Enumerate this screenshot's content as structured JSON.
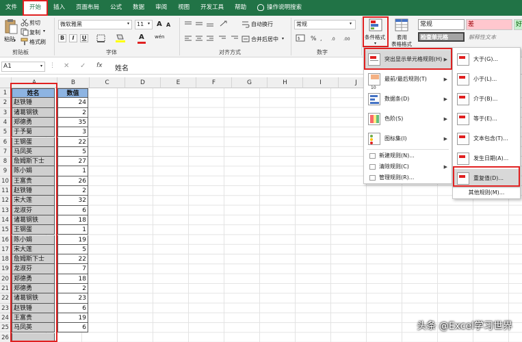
{
  "tabs": [
    "文件",
    "开始",
    "插入",
    "页面布局",
    "公式",
    "数据",
    "审阅",
    "视图",
    "开发工具",
    "帮助",
    "操作说明搜索"
  ],
  "clipboard": {
    "paste": "粘贴",
    "cut": "剪切",
    "copy": "复制",
    "format_painter": "格式刷",
    "label": "剪贴板"
  },
  "font": {
    "name": "微软雅黑",
    "size": "11",
    "bold": "B",
    "italic": "I",
    "underline": "U",
    "grow": "A",
    "shrink": "A",
    "color_a": "A",
    "wen": "wén",
    "label": "字体"
  },
  "alignment": {
    "wrap": "自动换行",
    "merge": "合并后居中",
    "label": "对齐方式"
  },
  "number": {
    "format": "常规",
    "label": "数字"
  },
  "styles": {
    "conditional": "条件格式",
    "table": "套用",
    "table2": "表格格式",
    "normal": "常规",
    "bad": "差",
    "good": "好",
    "check": "检查单元格",
    "explain": "解释性文本"
  },
  "formula_bar": {
    "name_box": "A1",
    "fx": "fx",
    "value": "姓名"
  },
  "columns": [
    "A",
    "B",
    "C",
    "D",
    "E",
    "F",
    "G",
    "H",
    "I",
    "J"
  ],
  "table": {
    "headers": [
      "姓名",
      "数值"
    ],
    "rows": [
      [
        "赵铁锤",
        "24"
      ],
      [
        "诸葛钢铁",
        "2"
      ],
      [
        "郑德勇",
        "35"
      ],
      [
        "于予菊",
        "3"
      ],
      [
        "王钢蛋",
        "22"
      ],
      [
        "马凤英",
        "5"
      ],
      [
        "詹姆斯下士",
        "27"
      ],
      [
        "陈小娟",
        "1"
      ],
      [
        "王富贵",
        "26"
      ],
      [
        "赵铁锤",
        "2"
      ],
      [
        "宋大莲",
        "32"
      ],
      [
        "龙淑芬",
        "6"
      ],
      [
        "诸葛钢铁",
        "18"
      ],
      [
        "王钢蛋",
        "1"
      ],
      [
        "陈小娟",
        "19"
      ],
      [
        "宋大莲",
        "5"
      ],
      [
        "詹姆斯下士",
        "22"
      ],
      [
        "龙淑芬",
        "7"
      ],
      [
        "郑德勇",
        "18"
      ],
      [
        "郑德勇",
        "2"
      ],
      [
        "诸葛钢铁",
        "23"
      ],
      [
        "赵铁锤",
        "6"
      ],
      [
        "王富贵",
        "19"
      ],
      [
        "马凤英",
        "6"
      ]
    ],
    "row_numbers": [
      "1",
      "2",
      "3",
      "4",
      "5",
      "6",
      "7",
      "8",
      "9",
      "10",
      "11",
      "12",
      "13",
      "14",
      "15",
      "16",
      "17",
      "18",
      "19",
      "20",
      "21",
      "22",
      "23",
      "24",
      "25",
      "26"
    ]
  },
  "cf_menu": {
    "items": [
      "突出显示单元格规则(H)",
      "最前/最后规则(T)",
      "数据条(D)",
      "色阶(S)",
      "图标集(I)"
    ],
    "small_items": [
      "新建规则(N)...",
      "清除规则(C)",
      "管理规则(R)..."
    ],
    "icon_label_10": "10"
  },
  "sub_menu": {
    "items": [
      "大于(G)...",
      "小于(L)...",
      "介于(B)...",
      "等于(E)...",
      "文本包含(T)...",
      "发生日期(A)...",
      "重复值(D)..."
    ],
    "more": "其他规则(M)..."
  },
  "watermark": "头条 @Excel学习世界",
  "colors": {
    "excel_green": "#217346",
    "header_blue": "#8db4e2",
    "highlight_red": "#e02020",
    "bad_fill": "#ffc7ce",
    "good_fill": "#c6efce",
    "check_fill": "#a5a5a5"
  }
}
